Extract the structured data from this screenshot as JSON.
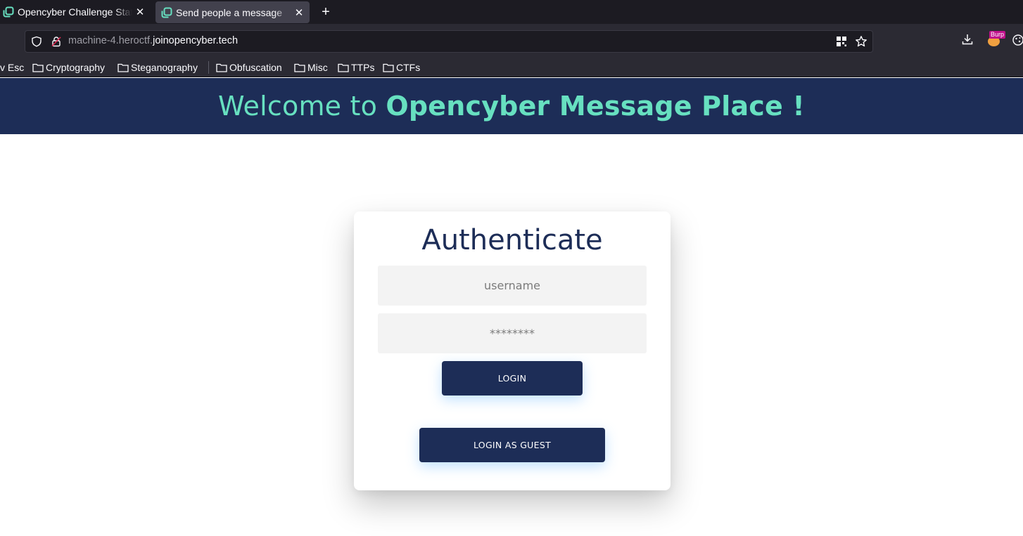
{
  "browser": {
    "tabs": [
      {
        "title": "Opencyber Challenge Stat",
        "active": false
      },
      {
        "title": "Send people a message",
        "active": true
      }
    ],
    "new_tab_label": "+",
    "close_glyph": "✕",
    "url": {
      "prefix": "machine-4.heroctf.",
      "domain": "joinopencyber.tech"
    },
    "bookmarks": [
      {
        "label": "v Esc"
      },
      {
        "label": "Cryptography"
      },
      {
        "label": "Steganography"
      },
      {
        "label": "Obfuscation"
      },
      {
        "label": "Misc"
      },
      {
        "label": "TTPs"
      },
      {
        "label": "CTFs"
      }
    ],
    "extension_badge": "Burp",
    "colors": {
      "tab_bar": "#1c1b22",
      "toolbar": "#2b2a33",
      "active_tab": "#42414d"
    }
  },
  "page": {
    "header": {
      "welcome": "Welcome to ",
      "site_name": "Opencyber Message Place !"
    },
    "auth": {
      "title": "Authenticate",
      "username_placeholder": "username",
      "password_placeholder": "********",
      "login_label": "LOGIN",
      "guest_label": "LOGIN AS GUEST"
    },
    "colors": {
      "navy": "#1d2d57",
      "mint": "#67e0c0",
      "field_bg": "#f3f3f3"
    }
  }
}
